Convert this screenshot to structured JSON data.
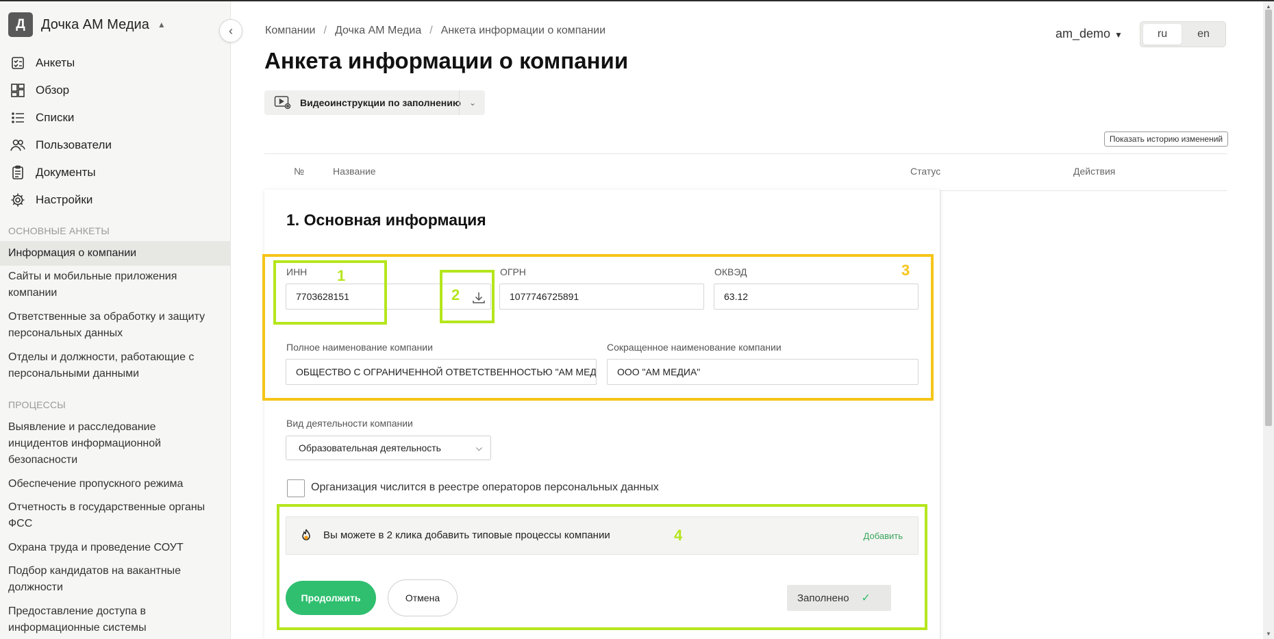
{
  "sidebar": {
    "company_initial": "Д",
    "company_name": "Дочка АМ Медиа",
    "nav": [
      {
        "label": "Анкеты",
        "icon": "checklist-icon"
      },
      {
        "label": "Обзор",
        "icon": "dashboard-icon"
      },
      {
        "label": "Списки",
        "icon": "list-icon"
      },
      {
        "label": "Пользователи",
        "icon": "users-icon"
      },
      {
        "label": "Документы",
        "icon": "clipboard-icon"
      },
      {
        "label": "Настройки",
        "icon": "gear-icon"
      }
    ],
    "section_main": "ОСНОВНЫЕ АНКЕТЫ",
    "main_items": [
      "Информация о компании",
      "Сайты и мобильные приложения компании",
      "Ответственные за обработку и защиту персональных данных",
      "Отделы и должности, работающие с персональными данными"
    ],
    "section_processes": "ПРОЦЕССЫ",
    "process_items": [
      "Выявление и расследование инцидентов информационной безопасности",
      "Обеспечение пропускного режима",
      "Отчетность в государственные органы ФСС",
      "Охрана труда и проведение СОУТ",
      "Подбор кандидатов на вакантные должности",
      "Предоставление доступа в информационные системы"
    ]
  },
  "header": {
    "breadcrumb": [
      "Компании",
      "Дочка АМ Медиа",
      "Анкета информации о компании"
    ],
    "title": "Анкета информации о компании",
    "user": "am_demo",
    "languages": [
      "ru",
      "en"
    ],
    "active_language": "ru"
  },
  "toolbar": {
    "video_label": "Видеоинструкции по заполнению",
    "history_label": "Показать историю изменений"
  },
  "table": {
    "col_num": "№",
    "col_name": "Название",
    "col_status": "Статус",
    "col_actions": "Действия"
  },
  "form": {
    "section_title": "1. Основная информация",
    "inn_label": "ИНН",
    "inn_value": "7703628151",
    "ogrn_label": "ОГРН",
    "ogrn_value": "1077746725891",
    "okved_label": "ОКВЭД",
    "okved_value": "63.12",
    "full_name_label": "Полное наименование компании",
    "full_name_value": "ОБЩЕСТВО С ОГРАНИЧЕННОЙ ОТВЕТСТВЕННОСТЬЮ \"АМ МЕДИА\"",
    "short_name_label": "Сокращенное наименование компании",
    "short_name_value": "ООО \"АМ МЕДИА\"",
    "activity_label": "Вид деятельности компании",
    "activity_value": "Образовательная деятельность",
    "registry_label": "Организация числится в реестре операторов персональных данных",
    "banner_text": "Вы можете в 2 клика добавить типовые процессы компании",
    "banner_link": "Добавить",
    "continue_label": "Продолжить",
    "cancel_label": "Отмена",
    "status_label": "Заполнено"
  },
  "annotations": {
    "n1": "1",
    "n2": "2",
    "n3": "3",
    "n4": "4",
    "green_color": "#b5e61d",
    "yellow_color": "#f5c518"
  }
}
